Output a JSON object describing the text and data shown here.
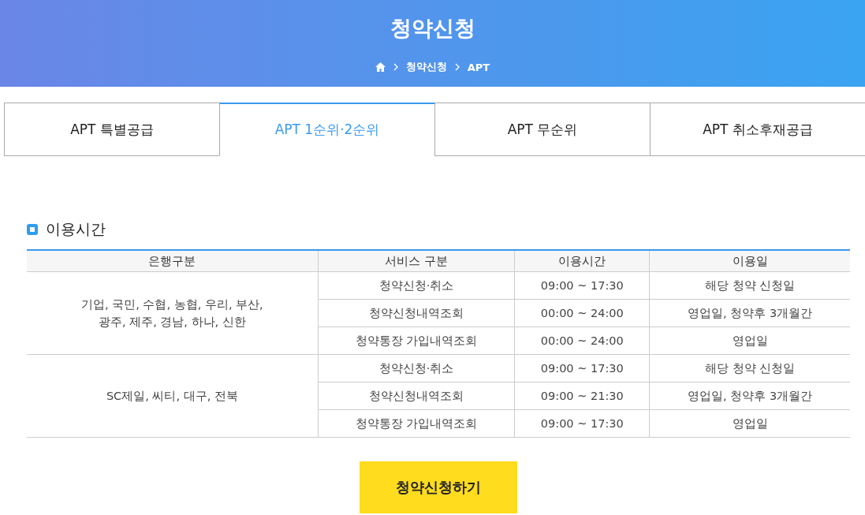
{
  "header": {
    "title": "청약신청",
    "breadcrumb": [
      "청약신청",
      "APT"
    ]
  },
  "tabs": [
    {
      "label": "APT 특별공급",
      "selected": false
    },
    {
      "label": "APT 1순위·2순위",
      "selected": true
    },
    {
      "label": "APT 무순위",
      "selected": false
    },
    {
      "label": "APT 취소후재공급",
      "selected": false
    }
  ],
  "section": {
    "title": "이용시간"
  },
  "table": {
    "columns": [
      "은행구분",
      "서비스 구분",
      "이용시간",
      "이용일"
    ],
    "groups": [
      {
        "banks": "기업, 국민, 수협, 농협, 우리, 부산,\n광주, 제주, 경남, 하나, 신한",
        "rows": [
          {
            "service": "청약신청·취소",
            "time": "09:00 ~ 17:30",
            "days": "해당 청약 신청일"
          },
          {
            "service": "청약신청내역조회",
            "time": "00:00 ~ 24:00",
            "days": "영업일, 청약후 3개월간"
          },
          {
            "service": "청약통장 가입내역조회",
            "time": "00:00 ~ 24:00",
            "days": "영업일"
          }
        ]
      },
      {
        "banks": "SC제일, 씨티, 대구, 전북",
        "rows": [
          {
            "service": "청약신청·취소",
            "time": "09:00 ~ 17:30",
            "days": "해당 청약 신청일"
          },
          {
            "service": "청약신청내역조회",
            "time": "09:00 ~ 21:30",
            "days": "영업일, 청약후 3개월간"
          },
          {
            "service": "청약통장 가입내역조회",
            "time": "09:00 ~ 17:30",
            "days": "영업일"
          }
        ]
      }
    ]
  },
  "button": {
    "label": "청약신청하기"
  }
}
